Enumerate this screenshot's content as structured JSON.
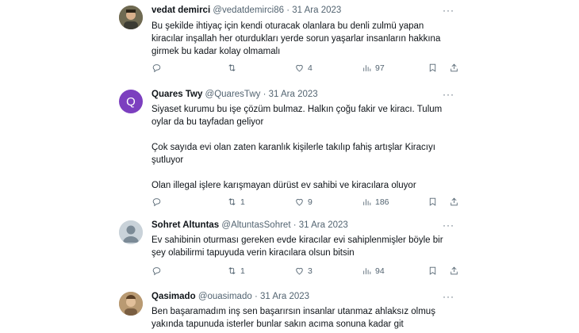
{
  "tweets": [
    {
      "name": "vedat demirci",
      "handle": "@vedatdemirci86",
      "dot": "·",
      "date": "31 Ara 2023",
      "more": "···",
      "lines": [
        "Bu şekilde ihtiyaç için kendi oturacak olanlara bu denli zulmü yapan",
        "kiracılar inşallah her oturdukları yerde sorun yaşarlar insanların hakkına",
        "girmek bu kadar kolay olmamalı"
      ],
      "replies": "",
      "retweets": "",
      "likes": "4",
      "views": "97"
    },
    {
      "name": "Quares Twy",
      "handle": "@QuaresTwy",
      "dot": "·",
      "date": "31 Ara 2023",
      "more": "···",
      "avatar_letter": "Q",
      "lines": [
        "Siyaset kurumu bu işe çözüm bulmaz. Halkın çoğu fakir ve kiracı. Tulum",
        "oylar da bu tayfadan geliyor",
        "",
        "Çok sayıda evi olan zaten karanlık kişilerle takılıp fahiş artışlar Kiracıyı",
        "şutluyor",
        "",
        "Olan illegal işlere karışmayan dürüst ev sahibi ve kiracılara oluyor"
      ],
      "replies": "",
      "retweets": "1",
      "likes": "9",
      "views": "186"
    },
    {
      "name": "Sohret Altuntas",
      "handle": "@AltuntasSohret",
      "dot": "·",
      "date": "31 Ara 2023",
      "more": "···",
      "lines": [
        "Ev sahibinin oturması gereken evde kiracılar evi sahiplenmişler böyle bir",
        "şey olabilirmi tapuyuda verin kiracılara olsun bitsin"
      ],
      "replies": "",
      "retweets": "1",
      "likes": "3",
      "views": "94"
    },
    {
      "name": "Qasimado",
      "handle": "@ouasimado",
      "dot": "·",
      "date": "31 Ara 2023",
      "more": "···",
      "lines": [
        "Ben başaramadım inş sen başarırsın insanlar utanmaz ahlaksız olmuş",
        "yakında tapunuda isterler bunlar sakın acıma sonuna kadar git"
      ]
    }
  ],
  "colors": {
    "text": "#0f1419",
    "muted": "#536471",
    "divider": "#eff3f4",
    "avatar_q": "#7c3fbf"
  },
  "icons": [
    "reply-icon",
    "retweet-icon",
    "like-icon",
    "views-icon",
    "bookmark-icon",
    "share-icon",
    "more-icon"
  ]
}
